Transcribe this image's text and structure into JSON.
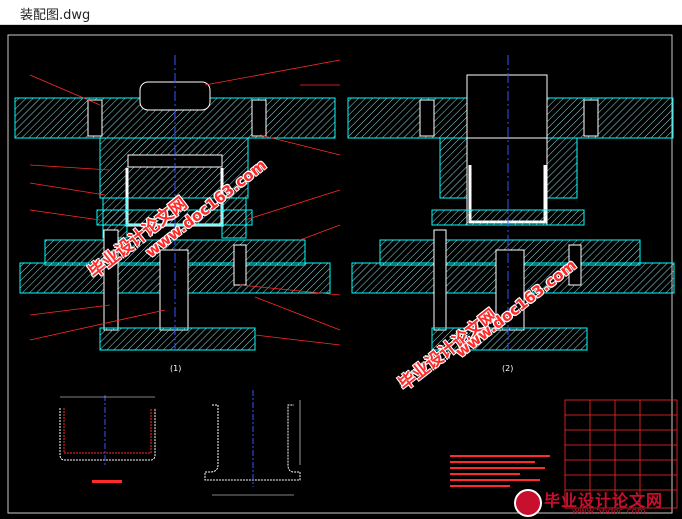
{
  "window": {
    "title": "装配图.dwg"
  },
  "drawing": {
    "view_left_label": "(1)",
    "view_right_label": "(2)",
    "colors": {
      "background": "#000000",
      "outline": "#00ffff",
      "hatch": "#8fdede",
      "centerline": "#3355ff",
      "leader": "#ff2a2a",
      "part": "#ffffff"
    }
  },
  "watermarks": [
    {
      "text": "毕业设计论文网"
    },
    {
      "text": "www.doc163.com"
    },
    {
      "text": "毕业设计论文网"
    },
    {
      "text": "www.doc163.com"
    }
  ],
  "logo": {
    "text": "毕业设计论文网",
    "url": "www.56doc.com",
    "icon": "logo-icon"
  }
}
